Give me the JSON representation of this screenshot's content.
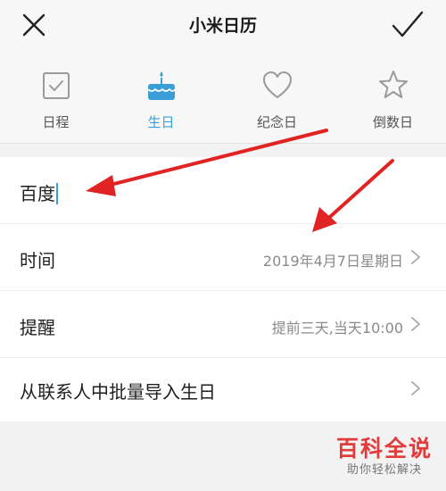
{
  "header": {
    "title": "小米日历",
    "close_icon": "close-icon",
    "confirm_icon": "check-icon"
  },
  "tabs": [
    {
      "label": "日程",
      "icon": "checkbox-icon",
      "active": false
    },
    {
      "label": "生日",
      "icon": "birthday-cake-icon",
      "active": true
    },
    {
      "label": "纪念日",
      "icon": "heart-icon",
      "active": false
    },
    {
      "label": "倒数日",
      "icon": "star-icon",
      "active": false
    }
  ],
  "form": {
    "name_value": "百度",
    "time_label": "时间",
    "time_value": "2019年4月7日星期日",
    "reminder_label": "提醒",
    "reminder_value": "提前三天,当天10:00",
    "import_label": "从联系人中批量导入生日"
  },
  "watermark": {
    "title": "百科全说",
    "subtitle": "助你轻松解决"
  },
  "colors": {
    "accent": "#3a9fd6",
    "arrow": "#e02424",
    "watermark": "#e23b3b"
  }
}
